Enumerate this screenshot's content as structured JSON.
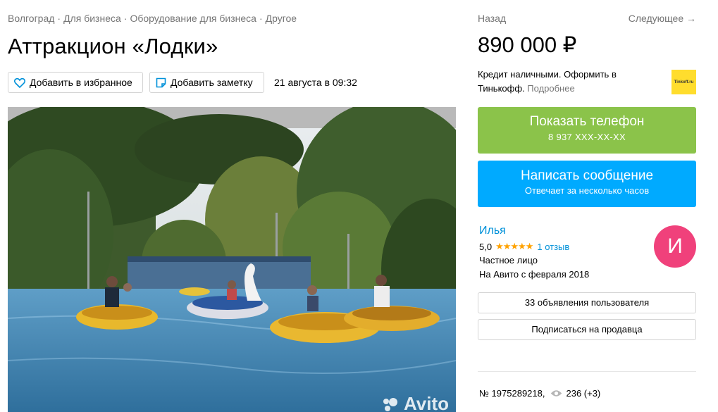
{
  "breadcrumb": {
    "items": [
      "Волгоград",
      "Для бизнеса",
      "Оборудование для бизнеса",
      "Другое"
    ],
    "separator": "·"
  },
  "listing": {
    "title": "Аттракцион «Лодки»",
    "date": "21 августа в 09:32",
    "photo_watermark": "Avito"
  },
  "actions": {
    "favorite_label": "Добавить в избранное",
    "note_label": "Добавить заметку"
  },
  "nav": {
    "back_label": "Назад",
    "next_label": "Следующее →"
  },
  "price": "890 000 ₽",
  "credit": {
    "text": "Кредит наличными. Оформить в Тинькофф.",
    "more_label": "Подробнее",
    "logo_text": "Tinkoff.ru"
  },
  "phone_button": {
    "label": "Показать телефон",
    "number": "8 937 XXX-XX-XX"
  },
  "message_button": {
    "label": "Написать сообщение",
    "sub": "Отвечает за несколько часов"
  },
  "seller": {
    "name": "Илья",
    "rating": "5,0",
    "stars": "★★★★★",
    "reviews_label": "1 отзыв",
    "type": "Частное лицо",
    "since": "На Авито с февраля 2018",
    "avatar_letter": "И"
  },
  "seller_actions": {
    "ads_label": "33 объявления пользователя",
    "subscribe_label": "Подписаться на продавца"
  },
  "meta": {
    "id": "№ 1975289218,",
    "views": "236 (+3)"
  },
  "colors": {
    "phone_button": "#8bc34a",
    "message_button": "#00aaff",
    "link": "#0091d9",
    "avatar": "#f0417b",
    "stars": "#ffa200"
  }
}
